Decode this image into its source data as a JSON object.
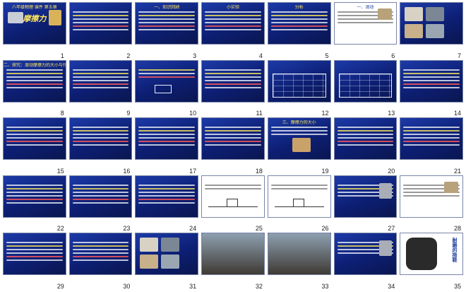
{
  "slide_sorter": {
    "slides": [
      {
        "number": "1",
        "title": "八年级物理·课件 第五章",
        "big_title": "摩擦力",
        "kind": "title"
      },
      {
        "number": "2",
        "title": "",
        "kind": "text"
      },
      {
        "number": "3",
        "title": "一、知识回顾",
        "kind": "text"
      },
      {
        "number": "4",
        "title": "小实验",
        "kind": "text"
      },
      {
        "number": "5",
        "title": "分析",
        "kind": "text"
      },
      {
        "number": "6",
        "title": "一、滑动",
        "kind": "light-pics"
      },
      {
        "number": "7",
        "title": "",
        "kind": "pics"
      },
      {
        "number": "8",
        "title": "二、探究：滑动摩擦力的大小与什么有关",
        "kind": "text"
      },
      {
        "number": "9",
        "title": "",
        "kind": "text"
      },
      {
        "number": "10",
        "title": "",
        "kind": "diagram"
      },
      {
        "number": "11",
        "title": "",
        "kind": "text"
      },
      {
        "number": "12",
        "title": "",
        "kind": "table"
      },
      {
        "number": "13",
        "title": "",
        "kind": "table"
      },
      {
        "number": "14",
        "title": "",
        "kind": "text"
      },
      {
        "number": "15",
        "title": "",
        "kind": "text"
      },
      {
        "number": "16",
        "title": "",
        "kind": "text"
      },
      {
        "number": "17",
        "title": "",
        "kind": "text"
      },
      {
        "number": "18",
        "title": "",
        "kind": "text"
      },
      {
        "number": "19",
        "title": "三、摩擦力的大小",
        "kind": "photo-inset"
      },
      {
        "number": "20",
        "title": "",
        "kind": "text"
      },
      {
        "number": "21",
        "title": "",
        "kind": "text"
      },
      {
        "number": "22",
        "title": "",
        "kind": "text"
      },
      {
        "number": "23",
        "title": "",
        "kind": "text"
      },
      {
        "number": "24",
        "title": "",
        "kind": "text"
      },
      {
        "number": "25",
        "title": "",
        "kind": "light-diagram"
      },
      {
        "number": "26",
        "title": "",
        "kind": "light-diagram"
      },
      {
        "number": "27",
        "title": "",
        "kind": "text-photo"
      },
      {
        "number": "28",
        "title": "",
        "kind": "light-pics"
      },
      {
        "number": "29",
        "title": "",
        "kind": "text"
      },
      {
        "number": "30",
        "title": "",
        "kind": "text"
      },
      {
        "number": "31",
        "title": "",
        "kind": "pics"
      },
      {
        "number": "32",
        "title": "",
        "kind": "photo"
      },
      {
        "number": "33",
        "title": "",
        "kind": "photo"
      },
      {
        "number": "34",
        "title": "",
        "kind": "text-photo"
      },
      {
        "number": "35",
        "title": "",
        "kind": "light-sandals",
        "caption": "耐磨的拖鞋"
      }
    ]
  }
}
